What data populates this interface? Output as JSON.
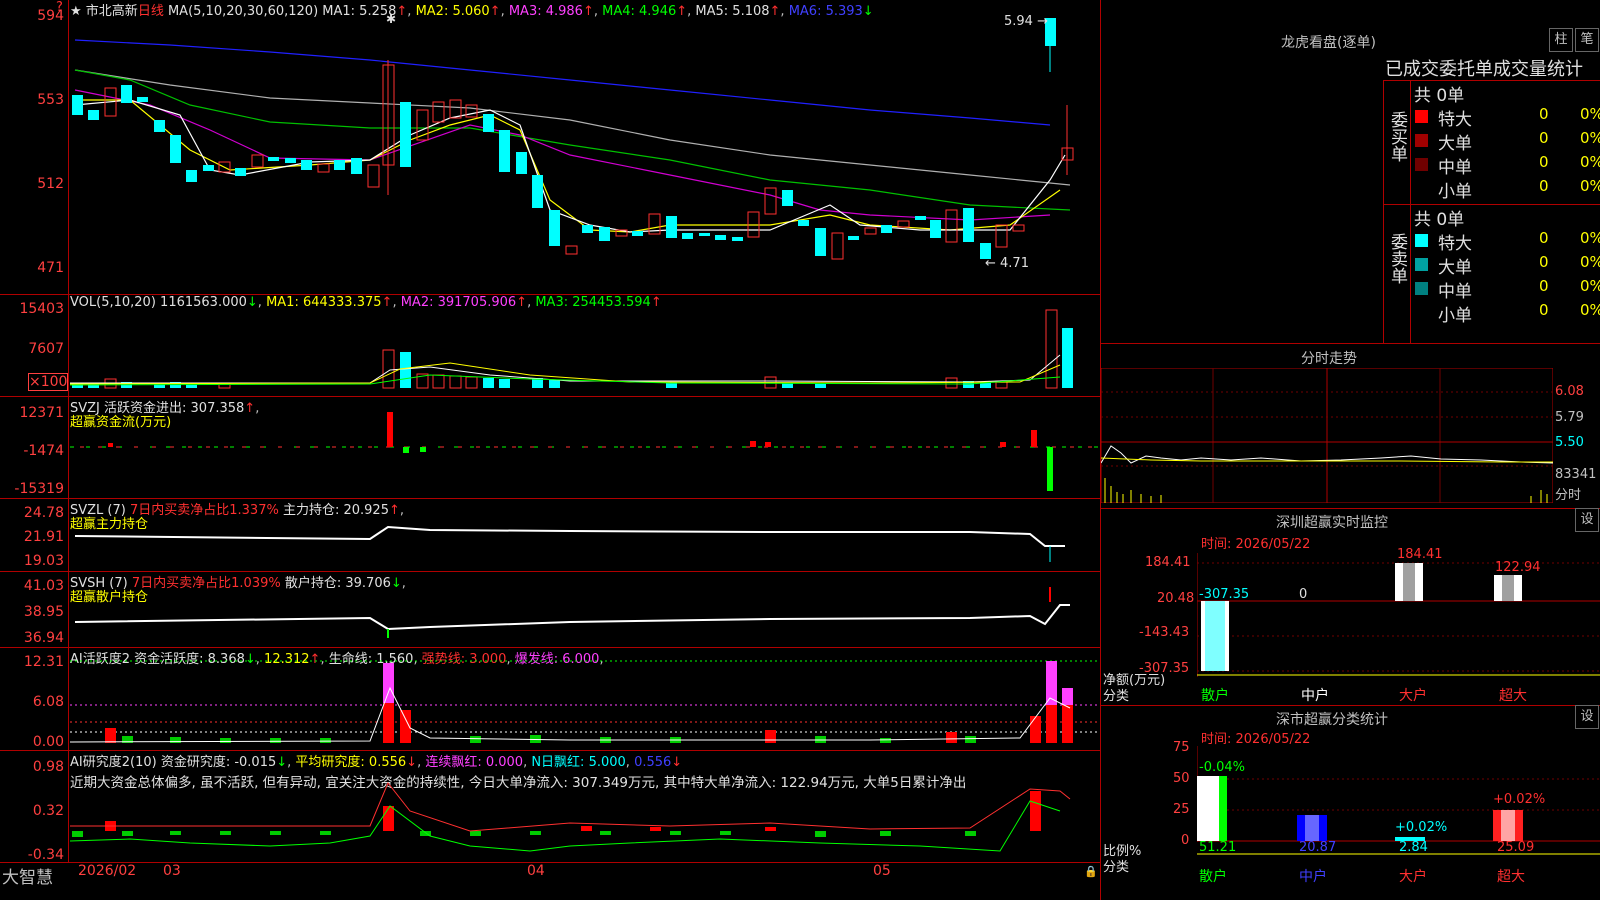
{
  "stock": {
    "title": "市北高新",
    "period": "日线",
    "star": "★",
    "ma_label": "MA(5,10,20,30,60,120)",
    "ma1": "MA1: 5.258",
    "ma2": "MA2: 5.060",
    "ma3": "MA3: 4.986",
    "ma4": "MA4: 4.946",
    "ma5": "MA5: 5.108",
    "ma6": "MA6: 5.393",
    "high_mark": "5.94",
    "low_mark": "4.71",
    "yticks": [
      "594",
      "553",
      "512",
      "471"
    ]
  },
  "vol": {
    "label": "VOL(5,10,20)",
    "value": "1161563.000",
    "ma1": "MA1: 644333.375",
    "ma2": "MA2: 391705.906",
    "ma3": "MA3: 254453.594",
    "yticks": [
      "15403",
      "7607",
      "×100"
    ]
  },
  "svzj": {
    "label": "SVZJ  活跃资金进出: 307.358",
    "sub": "超赢资金流(万元)",
    "yticks": [
      "12371",
      "-1474",
      "-15319"
    ]
  },
  "svzl": {
    "label": "SVZL (7)",
    "pct": "7日内买卖净占比1.337%",
    "hold": "主力持仓: 20.925",
    "sub": "超赢主力持仓",
    "yticks": [
      "24.78",
      "21.91",
      "19.03"
    ]
  },
  "svsh": {
    "label": "SVSH (7)",
    "pct": "7日内买卖净占比1.039%",
    "hold": "散户持仓: 39.706",
    "sub": "超赢散户持仓",
    "yticks": [
      "41.03",
      "38.95",
      "36.94"
    ]
  },
  "ai1": {
    "label": "AI活跃度2",
    "a": "资金活跃度: 8.368",
    "b": "12.312",
    "c": "生命线: 1.560",
    "d": "强势线: 3.000",
    "e": "爆发线: 6.000",
    "yticks": [
      "12.31",
      "6.08",
      "0.00"
    ]
  },
  "ai2": {
    "label": "AI研究度2(10)",
    "a": "资金研究度: -0.015",
    "b": "平均研究度: 0.556",
    "c": "连续飘红: 0.000",
    "d": "N日飘红: 5.000",
    "e": "0.556",
    "text": "近期大资金总体偏多, 虽不活跃, 但有异动, 宜关注大资金的持续性, 今日大单净流入: 307.349万元, 其中特大单净流入: 122.94万元, 大单5日累计净出",
    "yticks": [
      "0.98",
      "0.32",
      "-0.34"
    ]
  },
  "xaxis": {
    "brand": "大智慧",
    "labels": [
      "2026/02",
      "03",
      "04",
      "05"
    ]
  },
  "lhb": {
    "title": "龙虎看盘(逐单)",
    "btn1": "柱",
    "btn2": "笔",
    "subtitle": "已成交委托单成交量统计",
    "buy_label": "委买单",
    "sell_label": "委卖单",
    "buy_total": "共 0单",
    "sell_total": "共 0单",
    "rows": [
      {
        "name": "特大",
        "count": "0",
        "pct": "0%",
        "color": "#ff0000",
        "scolor": "#00ffff"
      },
      {
        "name": "大单",
        "count": "0",
        "pct": "0%",
        "color": "#a00000",
        "scolor": "#00a0a0"
      },
      {
        "name": "中单",
        "count": "0",
        "pct": "0%",
        "color": "#700000",
        "scolor": "#008080"
      },
      {
        "name": "小单",
        "count": "0",
        "pct": "0%",
        "color": "",
        "scolor": ""
      }
    ]
  },
  "fenshi": {
    "title": "分时走势",
    "yticks": [
      "6.08",
      "5.79",
      "5.50",
      "83341",
      "分时"
    ]
  },
  "sz_monitor": {
    "title": "深圳超赢实时监控",
    "btn": "设",
    "time": "时间: 2026/05/22",
    "yticks": [
      "184.41",
      "20.48",
      "-143.43",
      "-307.35"
    ],
    "values": [
      "-307.35",
      "0",
      "184.41",
      "122.94"
    ],
    "unit": "净额(万元)",
    "cat_label": "分类",
    "cats": [
      "散户",
      "中户",
      "大户",
      "超大"
    ]
  },
  "sz_class": {
    "title": "深市超赢分类统计",
    "btn": "设",
    "time": "时间: 2026/05/22",
    "yticks": [
      "75",
      "50",
      "25",
      "0"
    ],
    "top": [
      "-0.04%",
      "",
      "+0.02%",
      "+0.02%"
    ],
    "bottom": [
      "51.21",
      "20.87",
      "2.84",
      "25.09"
    ],
    "ratio_label": "比例%",
    "cat_label": "分类",
    "cats": [
      "散户",
      "中户",
      "大户",
      "超大"
    ]
  }
}
